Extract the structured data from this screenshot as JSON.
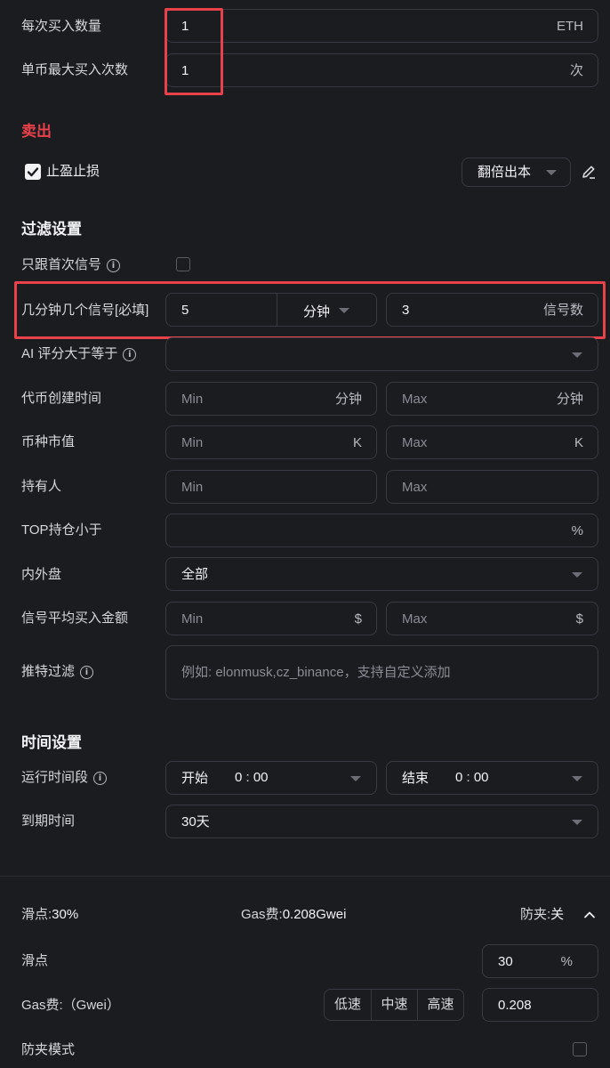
{
  "buy": {
    "amount_label": "每次买入数量",
    "amount_value": "1",
    "amount_unit": "ETH",
    "max_label": "单币最大买入次数",
    "max_value": "1",
    "max_unit": "次"
  },
  "sell": {
    "title": "卖出",
    "tp_sl_label": "止盈止损",
    "tp_sl_checked": true,
    "strategy_value": "翻倍出本"
  },
  "filter": {
    "title": "过滤设置",
    "first_signal_label": "只跟首次信号",
    "signals_label": "几分钟几个信号[必填]",
    "signals_minutes": "5",
    "signals_minutes_unit": "分钟",
    "signals_count": "3",
    "signals_count_unit": "信号数",
    "ai_label": "AI 评分大于等于",
    "created_label": "代币创建时间",
    "created_min": "Min",
    "created_max": "Max",
    "created_unit": "分钟",
    "mcap_label": "币种市值",
    "mcap_min": "Min",
    "mcap_max": "Max",
    "mcap_unit": "K",
    "holders_label": "持有人",
    "holders_min": "Min",
    "holders_max": "Max",
    "top_label": "TOP持仓小于",
    "top_unit": "%",
    "pool_label": "内外盘",
    "pool_value": "全部",
    "avgbuy_label": "信号平均买入金额",
    "avgbuy_min": "Min",
    "avgbuy_max": "Max",
    "avgbuy_unit": "$",
    "twitter_label": "推特过滤",
    "twitter_placeholder": "例如: elonmusk,cz_binance，支持自定义添加"
  },
  "time": {
    "title": "时间设置",
    "run_label": "运行时间段",
    "start_label": "开始",
    "start_value": "0 : 00",
    "end_label": "结束",
    "end_value": "0 : 00",
    "expire_label": "到期时间",
    "expire_value": "30天"
  },
  "trade": {
    "slippage_summary_label": "滑点:",
    "slippage_summary_value": "30%",
    "gas_summary_label": "Gas费:",
    "gas_summary_value": "0.208Gwei",
    "antimev_summary_label": "防夹:",
    "antimev_summary_value": "关",
    "slippage_label": "滑点",
    "slippage_value": "30",
    "slippage_unit": "%",
    "gas_label": "Gas费:（Gwei）",
    "gas_speeds": [
      "低速",
      "中速",
      "高速"
    ],
    "gas_value": "0.208",
    "antimev_label": "防夹模式"
  },
  "colors": {
    "accent_red": "#e8414a",
    "background": "#1b1c20",
    "border": "#383a41"
  }
}
